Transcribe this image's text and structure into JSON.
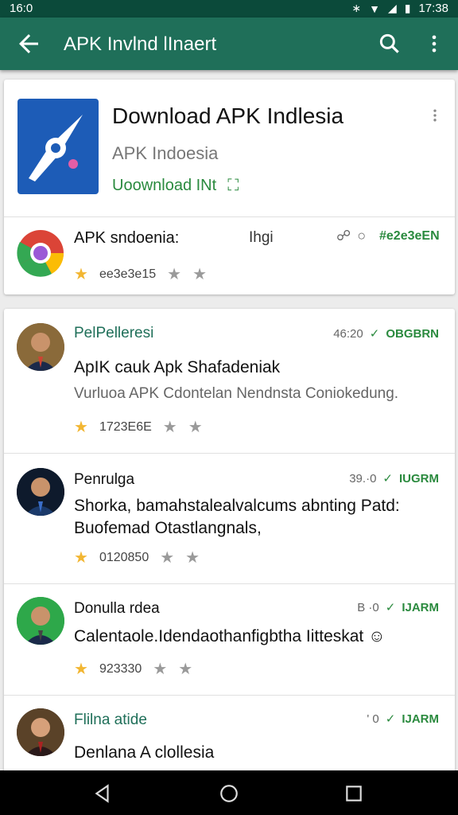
{
  "status": {
    "left": "16:0",
    "right": "17:38"
  },
  "appbar": {
    "title": "APK Invlnd lInaert"
  },
  "app": {
    "name": "Download APK Indlesia",
    "developer": "APK Indoesia",
    "install": "Uoownload INt",
    "accent": "#1d5cb7"
  },
  "mini": {
    "name": "APK sndoenia:",
    "extra": "Ihgi",
    "tag": "#e2e3eEN",
    "rating": "ee3e3e15"
  },
  "reviews": [
    {
      "name": "PelPelleresi",
      "name_color": "#1f6f59",
      "time": "46:20",
      "tag": "OBGBRN",
      "title": "ApIK cauk Apk Shafadeniak",
      "body": "Vurluoa APK Cdontelan Nendnsta Coniokedung.",
      "rating": "1723E6E"
    },
    {
      "name": "Penrulga",
      "name_color": "#111111",
      "time": "39.·0",
      "tag": "IUGRM",
      "title": "Shorka, bamahstalealvalcums abnting Patd: Buofemad Otastlangnals,",
      "body": "",
      "rating": "0120850"
    },
    {
      "name": "Donulla rdea",
      "name_color": "#111111",
      "time": "B ·0",
      "tag": "IJARM",
      "title": "Calentaole.Idendaothanfigbtha Iitteskat ☺",
      "body": "",
      "rating": "923330"
    },
    {
      "name": "Flilna atide",
      "name_color": "#1f6f59",
      "time": "' 0",
      "tag": "IJARM",
      "title": "Denlana A clollesia",
      "body": "",
      "rating": ""
    }
  ]
}
